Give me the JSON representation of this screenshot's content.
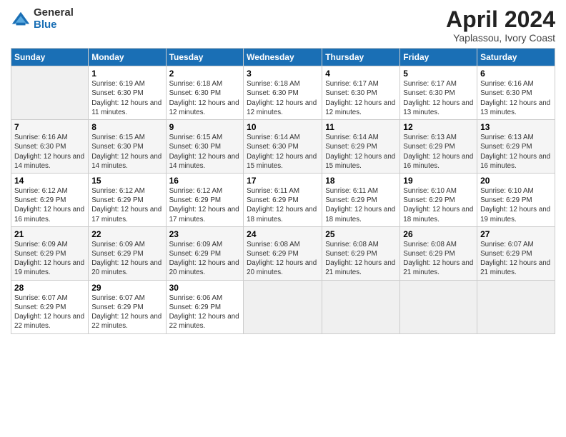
{
  "logo": {
    "general": "General",
    "blue": "Blue"
  },
  "title": "April 2024",
  "subtitle": "Yaplassou, Ivory Coast",
  "days_of_week": [
    "Sunday",
    "Monday",
    "Tuesday",
    "Wednesday",
    "Thursday",
    "Friday",
    "Saturday"
  ],
  "weeks": [
    [
      {
        "num": "",
        "sunrise": "",
        "sunset": "",
        "daylight": "",
        "empty": true
      },
      {
        "num": "1",
        "sunrise": "Sunrise: 6:19 AM",
        "sunset": "Sunset: 6:30 PM",
        "daylight": "Daylight: 12 hours and 11 minutes."
      },
      {
        "num": "2",
        "sunrise": "Sunrise: 6:18 AM",
        "sunset": "Sunset: 6:30 PM",
        "daylight": "Daylight: 12 hours and 12 minutes."
      },
      {
        "num": "3",
        "sunrise": "Sunrise: 6:18 AM",
        "sunset": "Sunset: 6:30 PM",
        "daylight": "Daylight: 12 hours and 12 minutes."
      },
      {
        "num": "4",
        "sunrise": "Sunrise: 6:17 AM",
        "sunset": "Sunset: 6:30 PM",
        "daylight": "Daylight: 12 hours and 12 minutes."
      },
      {
        "num": "5",
        "sunrise": "Sunrise: 6:17 AM",
        "sunset": "Sunset: 6:30 PM",
        "daylight": "Daylight: 12 hours and 13 minutes."
      },
      {
        "num": "6",
        "sunrise": "Sunrise: 6:16 AM",
        "sunset": "Sunset: 6:30 PM",
        "daylight": "Daylight: 12 hours and 13 minutes."
      }
    ],
    [
      {
        "num": "7",
        "sunrise": "Sunrise: 6:16 AM",
        "sunset": "Sunset: 6:30 PM",
        "daylight": "Daylight: 12 hours and 14 minutes."
      },
      {
        "num": "8",
        "sunrise": "Sunrise: 6:15 AM",
        "sunset": "Sunset: 6:30 PM",
        "daylight": "Daylight: 12 hours and 14 minutes."
      },
      {
        "num": "9",
        "sunrise": "Sunrise: 6:15 AM",
        "sunset": "Sunset: 6:30 PM",
        "daylight": "Daylight: 12 hours and 14 minutes."
      },
      {
        "num": "10",
        "sunrise": "Sunrise: 6:14 AM",
        "sunset": "Sunset: 6:30 PM",
        "daylight": "Daylight: 12 hours and 15 minutes."
      },
      {
        "num": "11",
        "sunrise": "Sunrise: 6:14 AM",
        "sunset": "Sunset: 6:29 PM",
        "daylight": "Daylight: 12 hours and 15 minutes."
      },
      {
        "num": "12",
        "sunrise": "Sunrise: 6:13 AM",
        "sunset": "Sunset: 6:29 PM",
        "daylight": "Daylight: 12 hours and 16 minutes."
      },
      {
        "num": "13",
        "sunrise": "Sunrise: 6:13 AM",
        "sunset": "Sunset: 6:29 PM",
        "daylight": "Daylight: 12 hours and 16 minutes."
      }
    ],
    [
      {
        "num": "14",
        "sunrise": "Sunrise: 6:12 AM",
        "sunset": "Sunset: 6:29 PM",
        "daylight": "Daylight: 12 hours and 16 minutes."
      },
      {
        "num": "15",
        "sunrise": "Sunrise: 6:12 AM",
        "sunset": "Sunset: 6:29 PM",
        "daylight": "Daylight: 12 hours and 17 minutes."
      },
      {
        "num": "16",
        "sunrise": "Sunrise: 6:12 AM",
        "sunset": "Sunset: 6:29 PM",
        "daylight": "Daylight: 12 hours and 17 minutes."
      },
      {
        "num": "17",
        "sunrise": "Sunrise: 6:11 AM",
        "sunset": "Sunset: 6:29 PM",
        "daylight": "Daylight: 12 hours and 18 minutes."
      },
      {
        "num": "18",
        "sunrise": "Sunrise: 6:11 AM",
        "sunset": "Sunset: 6:29 PM",
        "daylight": "Daylight: 12 hours and 18 minutes."
      },
      {
        "num": "19",
        "sunrise": "Sunrise: 6:10 AM",
        "sunset": "Sunset: 6:29 PM",
        "daylight": "Daylight: 12 hours and 18 minutes."
      },
      {
        "num": "20",
        "sunrise": "Sunrise: 6:10 AM",
        "sunset": "Sunset: 6:29 PM",
        "daylight": "Daylight: 12 hours and 19 minutes."
      }
    ],
    [
      {
        "num": "21",
        "sunrise": "Sunrise: 6:09 AM",
        "sunset": "Sunset: 6:29 PM",
        "daylight": "Daylight: 12 hours and 19 minutes."
      },
      {
        "num": "22",
        "sunrise": "Sunrise: 6:09 AM",
        "sunset": "Sunset: 6:29 PM",
        "daylight": "Daylight: 12 hours and 20 minutes."
      },
      {
        "num": "23",
        "sunrise": "Sunrise: 6:09 AM",
        "sunset": "Sunset: 6:29 PM",
        "daylight": "Daylight: 12 hours and 20 minutes."
      },
      {
        "num": "24",
        "sunrise": "Sunrise: 6:08 AM",
        "sunset": "Sunset: 6:29 PM",
        "daylight": "Daylight: 12 hours and 20 minutes."
      },
      {
        "num": "25",
        "sunrise": "Sunrise: 6:08 AM",
        "sunset": "Sunset: 6:29 PM",
        "daylight": "Daylight: 12 hours and 21 minutes."
      },
      {
        "num": "26",
        "sunrise": "Sunrise: 6:08 AM",
        "sunset": "Sunset: 6:29 PM",
        "daylight": "Daylight: 12 hours and 21 minutes."
      },
      {
        "num": "27",
        "sunrise": "Sunrise: 6:07 AM",
        "sunset": "Sunset: 6:29 PM",
        "daylight": "Daylight: 12 hours and 21 minutes."
      }
    ],
    [
      {
        "num": "28",
        "sunrise": "Sunrise: 6:07 AM",
        "sunset": "Sunset: 6:29 PM",
        "daylight": "Daylight: 12 hours and 22 minutes."
      },
      {
        "num": "29",
        "sunrise": "Sunrise: 6:07 AM",
        "sunset": "Sunset: 6:29 PM",
        "daylight": "Daylight: 12 hours and 22 minutes."
      },
      {
        "num": "30",
        "sunrise": "Sunrise: 6:06 AM",
        "sunset": "Sunset: 6:29 PM",
        "daylight": "Daylight: 12 hours and 22 minutes."
      },
      {
        "num": "",
        "sunrise": "",
        "sunset": "",
        "daylight": "",
        "empty": true
      },
      {
        "num": "",
        "sunrise": "",
        "sunset": "",
        "daylight": "",
        "empty": true
      },
      {
        "num": "",
        "sunrise": "",
        "sunset": "",
        "daylight": "",
        "empty": true
      },
      {
        "num": "",
        "sunrise": "",
        "sunset": "",
        "daylight": "",
        "empty": true
      }
    ]
  ]
}
